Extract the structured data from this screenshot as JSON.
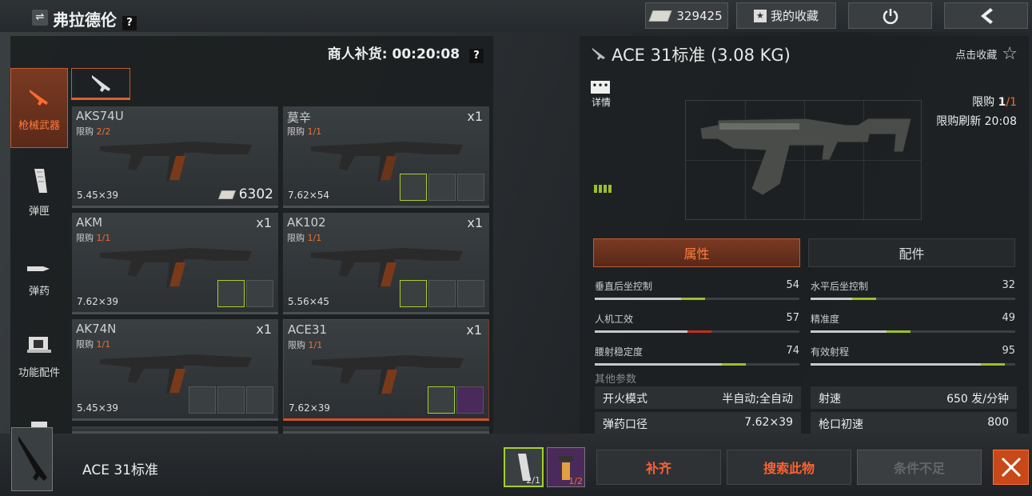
{
  "header": {
    "trader_name": "弗拉德伦",
    "help": "?",
    "money": "329425",
    "favorites_label": "我的收藏"
  },
  "left": {
    "restock_label": "商人补货: 00:20:08",
    "help": "?",
    "categories": [
      {
        "label": "枪械武器",
        "icon": "rifle-icon",
        "active": true
      },
      {
        "label": "弹匣",
        "icon": "magazine-icon",
        "active": false
      },
      {
        "label": "弹药",
        "icon": "ammo-icon",
        "active": false
      },
      {
        "label": "功能配件",
        "icon": "scope-icon",
        "active": false
      }
    ],
    "cards": [
      {
        "name": "AKS74U",
        "limit_prefix": "限购",
        "limit": "2/2",
        "qty": "",
        "caliber": "5.45×39",
        "price": "6302"
      },
      {
        "name": "莫辛",
        "limit_prefix": "限购",
        "limit": "1/1",
        "qty": "x1",
        "caliber": "7.62×54",
        "price": ""
      },
      {
        "name": "AKM",
        "limit_prefix": "限购",
        "limit": "1/1",
        "qty": "x1",
        "caliber": "7.62×39",
        "price": ""
      },
      {
        "name": "AK102",
        "limit_prefix": "限购",
        "limit": "1/1",
        "qty": "x1",
        "caliber": "5.56×45",
        "price": ""
      },
      {
        "name": "AK74N",
        "limit_prefix": "限购",
        "limit": "1/1",
        "qty": "x1",
        "caliber": "5.45×39",
        "price": ""
      },
      {
        "name": "ACE31",
        "limit_prefix": "限购",
        "limit": "1/1",
        "qty": "x1",
        "caliber": "7.62×39",
        "price": ""
      }
    ]
  },
  "right": {
    "title": "ACE 31标准 (3.08 KG)",
    "fav_label": "点击收藏",
    "detail_label": "详情",
    "limit_prefix": "限购",
    "limit_value": "1",
    "limit_total": "/1",
    "refresh_label": "限购刷新 20:08",
    "tab_attr": "属性",
    "tab_parts": "配件",
    "stats": [
      {
        "label": "垂直后坐控制",
        "value": 54,
        "color": "#9ac02a"
      },
      {
        "label": "水平后坐控制",
        "value": 32,
        "color": "#9ac02a"
      },
      {
        "label": "人机工效",
        "value": 57,
        "color": "#c03020"
      },
      {
        "label": "精准度",
        "value": 49,
        "color": "#9ac02a"
      },
      {
        "label": "腰射稳定度",
        "value": 74,
        "color": "#9ac02a"
      },
      {
        "label": "有效射程",
        "value": 95,
        "color": "#9ac02a"
      }
    ],
    "other_title": "其他参数",
    "params": [
      {
        "label": "开火模式",
        "value": "半自动;全自动"
      },
      {
        "label": "射速",
        "value": "650 发/分钟"
      },
      {
        "label": "弹药口径",
        "value": "7.62×39"
      },
      {
        "label": "枪口初速",
        "value": "800"
      }
    ]
  },
  "bottom": {
    "item_name": "ACE 31标准",
    "req1": "2/1",
    "req2": "1/2",
    "btn_fill": "补齐",
    "btn_search": "搜索此物",
    "btn_unmet": "条件不足"
  }
}
